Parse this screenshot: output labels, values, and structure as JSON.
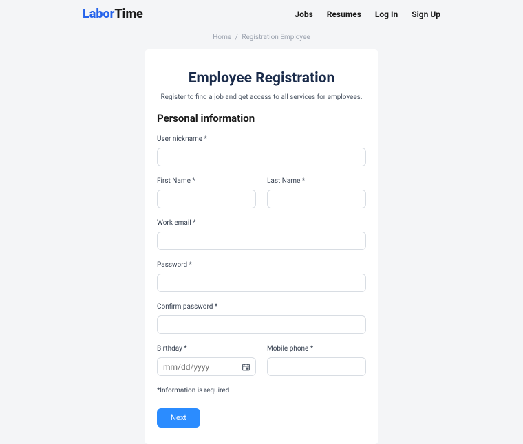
{
  "header": {
    "logo_labor": "Labor",
    "logo_time": "Time",
    "nav": {
      "jobs": "Jobs",
      "resumes": "Resumes",
      "login": "Log In",
      "signup": "Sign Up"
    }
  },
  "breadcrumb": {
    "home": "Home",
    "sep": "/",
    "current": "Registration Employee"
  },
  "page": {
    "title": "Employee Registration",
    "subtitle": "Register to find a job and get access to all services for employees.",
    "section_title": "Personal information",
    "hint": "*Information is required",
    "next_button": "Next"
  },
  "form": {
    "nickname_label": "User nickname *",
    "first_name_label": "First Name *",
    "last_name_label": "Last Name *",
    "email_label": "Work email *",
    "password_label": "Password *",
    "confirm_password_label": "Confirm password *",
    "birthday_label": "Birthday *",
    "birthday_placeholder": "mm/dd/yyyy",
    "phone_label": "Mobile phone *"
  }
}
